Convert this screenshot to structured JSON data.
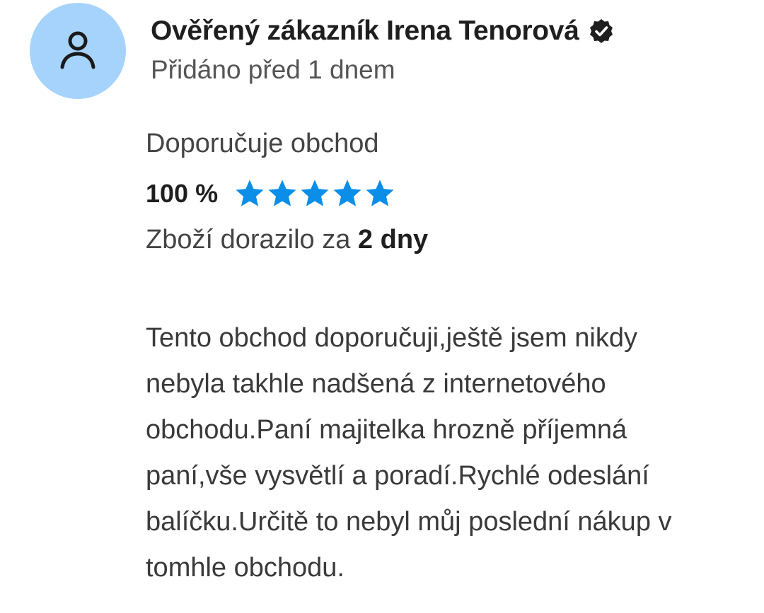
{
  "review": {
    "author": "Ověřený zákazník Irena Tenorová",
    "verified_icon": "check-circle-icon",
    "added": "Přidáno před 1 dnem",
    "recommend_label": "Doporučuje obchod",
    "rating_percent": "100 %",
    "stars": {
      "filled": 5,
      "total": 5,
      "color": "#0a8ee8"
    },
    "delivery_prefix": "Zboží dorazilo za ",
    "delivery_value": "2 dny",
    "text_lines": [
      "Tento obchod doporučuji,ještě jsem nikdy",
      "nebyla takhle nadšená z internetového",
      "obchodu.Paní majitelka hrozně příjemná",
      "paní,vše vysvětlí a poradí.Rychlé odeslání",
      "balíčku.Určitě to nebyl můj poslední nákup v",
      "tomhle obchodu."
    ]
  },
  "colors": {
    "avatar_bg": "#a6d3fb",
    "star": "#0a8ee8",
    "text_dark": "#1f1f1f"
  },
  "icons": {
    "avatar": "user-icon",
    "verified": "check-circle-icon",
    "star": "star-icon"
  }
}
